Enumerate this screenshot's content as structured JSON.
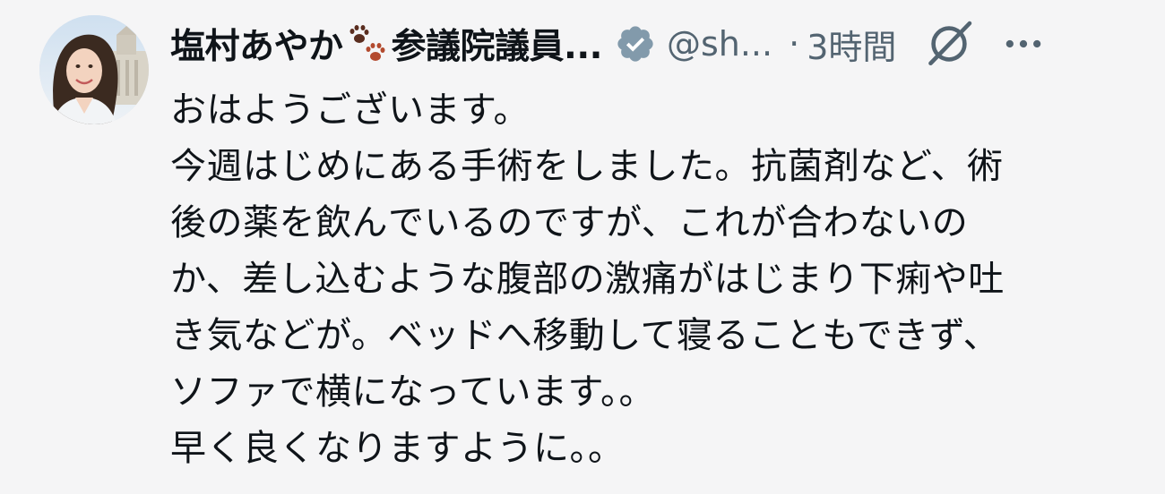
{
  "author": {
    "name": "塩村あやか",
    "paw_emoji": "paw-prints-icon",
    "title_truncated": "参議院議員...",
    "handle_truncated": "@sh...",
    "verified": "verified-badge-icon"
  },
  "meta": {
    "separator": "·",
    "time": "3時間"
  },
  "actions": {
    "grok": "grok-icon",
    "more": "more-icon"
  },
  "body": {
    "lines": [
      "おはようございます。",
      "今週はじめにある手術をしました。抗菌剤など、術",
      "後の薬を飲んでいるのですが、これが合わないの",
      "か、差し込むような腹部の激痛がはじまり下痢や吐",
      "き気などが。ベッドへ移動して寝ることもできず、",
      "ソファで横になっています。。",
      "早く良くなりますように。。"
    ]
  },
  "colors": {
    "background": "#f5f5f6",
    "text": "#0f1419",
    "secondary": "#536471",
    "verified_badge": "#829aab"
  }
}
